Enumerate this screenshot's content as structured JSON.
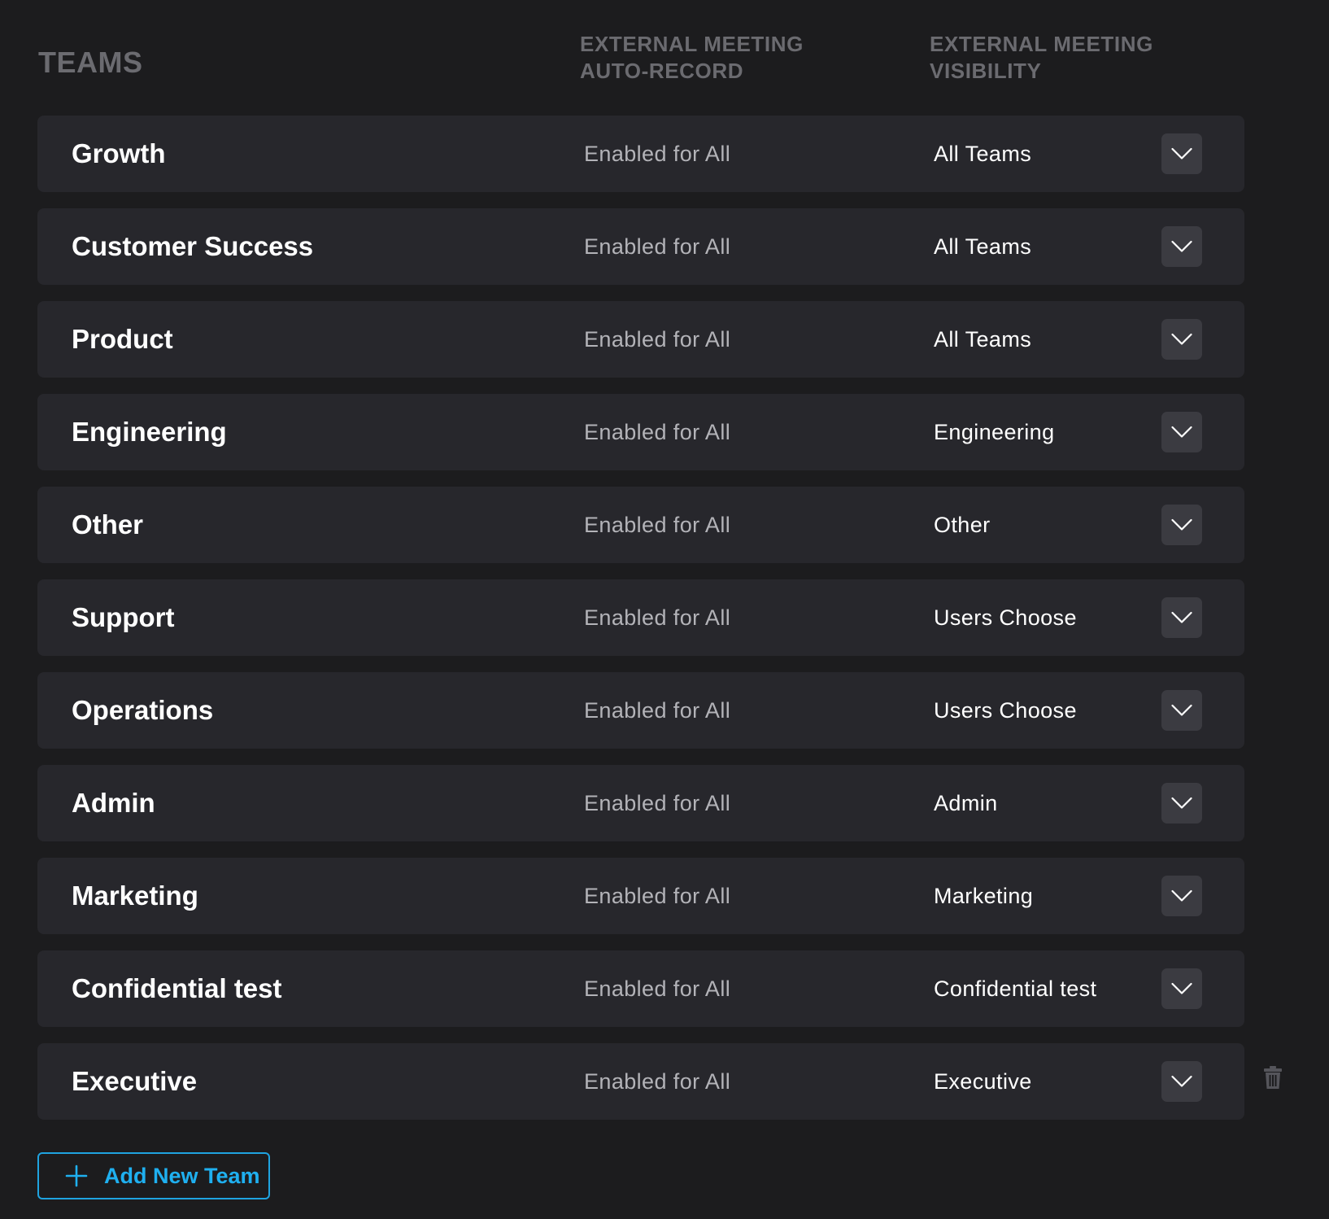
{
  "header": {
    "teams": "TEAMS",
    "auto_record_line1": "EXTERNAL MEETING",
    "auto_record_line2": "AUTO-RECORD",
    "visibility_line1": "EXTERNAL MEETING",
    "visibility_line2": "VISIBILITY"
  },
  "rows": [
    {
      "team": "Growth",
      "auto_record": "Enabled for All",
      "visibility": "All Teams"
    },
    {
      "team": "Customer Success",
      "auto_record": "Enabled for All",
      "visibility": "All Teams"
    },
    {
      "team": "Product",
      "auto_record": "Enabled for All",
      "visibility": "All Teams"
    },
    {
      "team": "Engineering",
      "auto_record": "Enabled for All",
      "visibility": "Engineering"
    },
    {
      "team": "Other",
      "auto_record": "Enabled for All",
      "visibility": "Other"
    },
    {
      "team": "Support",
      "auto_record": "Enabled for All",
      "visibility": "Users Choose"
    },
    {
      "team": "Operations",
      "auto_record": "Enabled for All",
      "visibility": "Users Choose"
    },
    {
      "team": "Admin",
      "auto_record": "Enabled for All",
      "visibility": "Admin"
    },
    {
      "team": "Marketing",
      "auto_record": "Enabled for All",
      "visibility": "Marketing"
    },
    {
      "team": "Confidential test",
      "auto_record": "Enabled for All",
      "visibility": "Confidential test"
    },
    {
      "team": "Executive",
      "auto_record": "Enabled for All",
      "visibility": "Executive"
    }
  ],
  "icons": {
    "dropdown": "chevron-down-icon",
    "delete": "trash-icon",
    "add": "plus-icon"
  },
  "add_button": {
    "label": "Add New Team"
  },
  "colors": {
    "background": "#1c1c1e",
    "row_background": "#27272c",
    "accent": "#1fb0f0",
    "header_text": "#6b6b70"
  }
}
